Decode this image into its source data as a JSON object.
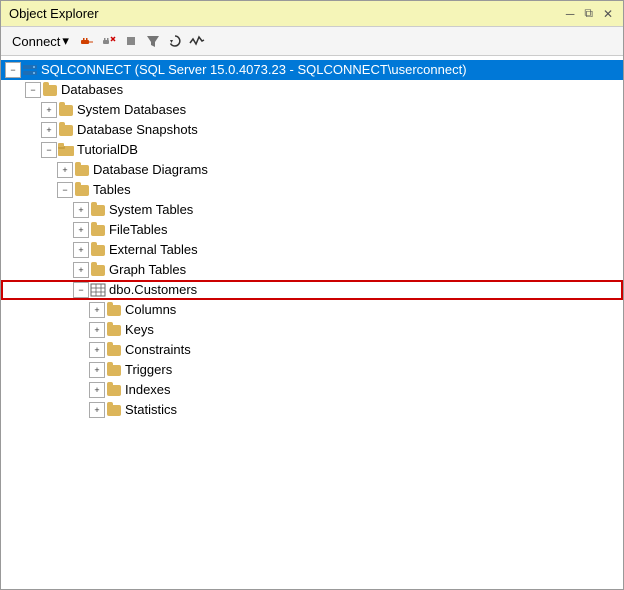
{
  "window": {
    "title": "Object Explorer",
    "title_pin": "📌",
    "title_close": "✕"
  },
  "toolbar": {
    "connect_label": "Connect",
    "connect_arrow": "▼",
    "icons": [
      {
        "name": "connect-object-icon",
        "symbol": "⬥",
        "color": "#d04000"
      },
      {
        "name": "disconnect-icon",
        "symbol": "✕",
        "color": "#cc0000"
      },
      {
        "name": "stop-icon",
        "symbol": "■",
        "color": "#888"
      },
      {
        "name": "filter-icon",
        "symbol": "▽",
        "color": "#555"
      },
      {
        "name": "refresh-icon",
        "symbol": "↻",
        "color": "#333"
      },
      {
        "name": "activity-monitor-icon",
        "symbol": "∿",
        "color": "#333"
      }
    ]
  },
  "tree": {
    "root": {
      "label": "SQLCONNECT (SQL Server 15.0.4073.23 - SQLCONNECT\\userconnect)",
      "expanded": true,
      "selected": true
    },
    "nodes": [
      {
        "id": "databases",
        "label": "Databases",
        "indent": 2,
        "expanded": true,
        "icon": "folder"
      },
      {
        "id": "system-databases",
        "label": "System Databases",
        "indent": 3,
        "expanded": false,
        "icon": "folder"
      },
      {
        "id": "database-snapshots",
        "label": "Database Snapshots",
        "indent": 3,
        "expanded": false,
        "icon": "folder"
      },
      {
        "id": "tutorialdb",
        "label": "TutorialDB",
        "indent": 3,
        "expanded": true,
        "icon": "folder"
      },
      {
        "id": "database-diagrams",
        "label": "Database Diagrams",
        "indent": 4,
        "expanded": false,
        "icon": "folder"
      },
      {
        "id": "tables",
        "label": "Tables",
        "indent": 4,
        "expanded": true,
        "icon": "folder"
      },
      {
        "id": "system-tables",
        "label": "System Tables",
        "indent": 5,
        "expanded": false,
        "icon": "folder"
      },
      {
        "id": "file-tables",
        "label": "FileTables",
        "indent": 5,
        "expanded": false,
        "icon": "folder"
      },
      {
        "id": "external-tables",
        "label": "External Tables",
        "indent": 5,
        "expanded": false,
        "icon": "folder"
      },
      {
        "id": "graph-tables",
        "label": "Graph Tables",
        "indent": 5,
        "expanded": false,
        "icon": "folder"
      },
      {
        "id": "dbo-customers",
        "label": "dbo.Customers",
        "indent": 5,
        "expanded": true,
        "icon": "table",
        "highlighted": true
      },
      {
        "id": "columns",
        "label": "Columns",
        "indent": 6,
        "expanded": false,
        "icon": "folder"
      },
      {
        "id": "keys",
        "label": "Keys",
        "indent": 6,
        "expanded": false,
        "icon": "folder"
      },
      {
        "id": "constraints",
        "label": "Constraints",
        "indent": 6,
        "expanded": false,
        "icon": "folder"
      },
      {
        "id": "triggers",
        "label": "Triggers",
        "indent": 6,
        "expanded": false,
        "icon": "folder"
      },
      {
        "id": "indexes",
        "label": "Indexes",
        "indent": 6,
        "expanded": false,
        "icon": "folder"
      },
      {
        "id": "statistics",
        "label": "Statistics",
        "indent": 6,
        "expanded": false,
        "icon": "folder"
      }
    ]
  }
}
